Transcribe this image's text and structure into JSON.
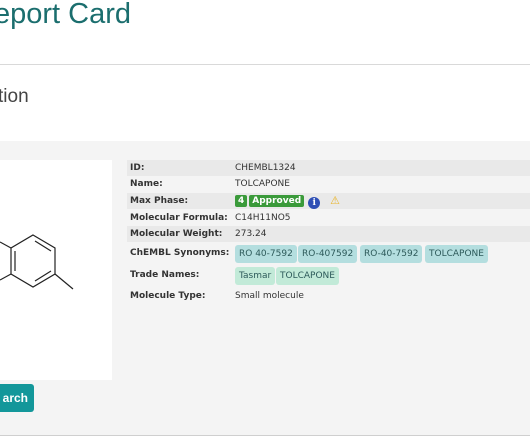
{
  "header": {
    "title": "eport Card"
  },
  "section": {
    "title": "tion"
  },
  "actions": {
    "search_label": "arch"
  },
  "compound": {
    "id_label": "ID:",
    "id_value": "CHEMBL1324",
    "name_label": "Name:",
    "name_value": "TOLCAPONE",
    "max_phase_label": "Max Phase:",
    "max_phase_value": "4",
    "max_phase_status": "Approved",
    "formula_label": "Molecular Formula:",
    "formula_value": "C14H11NO5",
    "weight_label": "Molecular Weight:",
    "weight_value": "273.24",
    "synonyms_label": "ChEMBL Synonyms:",
    "synonyms": [
      "RO 40-7592",
      "RO-407592",
      "RO-40-7592",
      "TOLCAPONE"
    ],
    "trade_names_label": "Trade Names:",
    "trade_names": [
      "Tasmar",
      "TOLCAPONE"
    ],
    "type_label": "Molecule Type:",
    "type_value": "Small molecule"
  },
  "icons": {
    "info": "info-icon",
    "warning": "warning-icon"
  },
  "colors": {
    "accent": "#13979a",
    "title": "#1b6e6e",
    "phase_badge": "#3a9a3a",
    "chip": "#b4dedf",
    "chip_trade": "#c2ead8"
  }
}
